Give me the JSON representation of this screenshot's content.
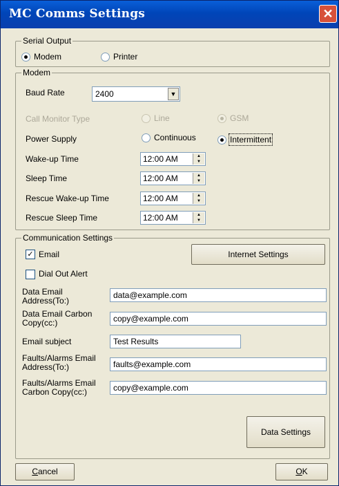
{
  "window": {
    "title": "MC Comms Settings",
    "close_glyph": "✕"
  },
  "serial_output": {
    "legend": "Serial Output",
    "options": [
      {
        "label": "Modem",
        "selected": true
      },
      {
        "label": "Printer",
        "selected": false
      }
    ]
  },
  "modem": {
    "legend": "Modem",
    "baud_rate": {
      "label": "Baud Rate",
      "value": "2400",
      "arrow": "▼"
    },
    "call_monitor": {
      "label": "Call Monitor Type",
      "options": [
        {
          "label": "Line",
          "selected": false
        },
        {
          "label": "GSM",
          "selected": true
        }
      ],
      "enabled": false
    },
    "power_supply": {
      "label": "Power Supply",
      "options": [
        {
          "label": "Continuous",
          "selected": false
        },
        {
          "label": "Intermittent",
          "selected": true
        }
      ]
    },
    "times": [
      {
        "label": "Wake-up Time",
        "value": "12:00 AM"
      },
      {
        "label": "Sleep Time",
        "value": "12:00 AM"
      },
      {
        "label": "Rescue Wake-up Time",
        "value": "12:00 AM"
      },
      {
        "label": "Rescue Sleep Time",
        "value": "12:00 AM"
      }
    ],
    "spin_up": "▲",
    "spin_down": "▼"
  },
  "communication": {
    "legend": "Communication Settings",
    "email": {
      "label": "Email",
      "checked": true,
      "mark": "✓"
    },
    "dial_out": {
      "label": "Dial Out Alert",
      "checked": false
    },
    "internet_settings_button": "Internet Settings",
    "fields": [
      {
        "label_line1": "Data Email",
        "label_line2": "Address(To:)",
        "value": "data@example.com"
      },
      {
        "label_line1": "Data Email Carbon",
        "label_line2": "Copy(cc:)",
        "value": "copy@example.com"
      },
      {
        "label_line1": "Email subject",
        "label_line2": "",
        "value": "Test Results"
      },
      {
        "label_line1": "Faults/Alarms Email",
        "label_line2": "Address(To:)",
        "value": "faults@example.com"
      },
      {
        "label_line1": "Faults/Alarms Email",
        "label_line2": "Carbon Copy(cc:)",
        "value": "copy@example.com"
      }
    ],
    "data_settings_button": "Data Settings"
  },
  "footer": {
    "cancel_label": "Cancel",
    "cancel_accel": "C",
    "cancel_rest": "ancel",
    "ok_accel": "O",
    "ok_rest": "K"
  }
}
